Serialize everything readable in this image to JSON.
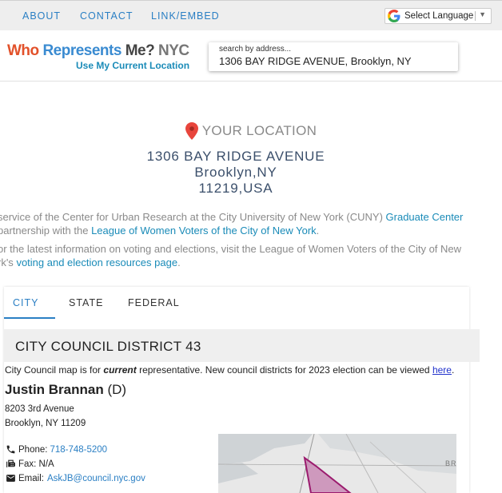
{
  "nav": {
    "links": [
      "ABOUT",
      "CONTACT",
      "LINK/EMBED"
    ],
    "language_label": "Select Language"
  },
  "header": {
    "logo": {
      "who": "Who",
      "represents": "Represents",
      "me": "Me?",
      "nyc": "NYC"
    },
    "current_location_label": "Use My Current Location",
    "search_label": "search by address...",
    "search_value": "1306 BAY RIDGE AVENUE, Brooklyn, NY"
  },
  "location": {
    "title": "YOUR LOCATION",
    "street": "1306 BAY RIDGE AVENUE",
    "city": "Brooklyn,NY",
    "zip": "11219,USA"
  },
  "intro": {
    "line1_text": "service of the Center for Urban Research at the City University of New York (CUNY)",
    "line1_link": "Graduate Center",
    "line2_text": "partnership with the",
    "line2_link": "League of Women Voters of the City of New York",
    "line3_text": "or the latest information on voting and elections, visit the League of Women Voters of the City of New",
    "line4_text": "rk's",
    "line4_link": "voting and election resources page"
  },
  "tabs": [
    "CITY",
    "STATE",
    "FEDERAL"
  ],
  "district": {
    "title": "CITY COUNCIL DISTRICT 43",
    "note_prefix": "City Council map is for",
    "note_emph": "current",
    "note_mid": "representative. New council districts for 2023 election can be viewed",
    "note_link": "here",
    "rep_name": "Justin Brannan",
    "rep_party": "(D)",
    "address_line1": "8203 3rd Avenue",
    "address_line2": "Brooklyn, NY 11209",
    "phone_label": "Phone:",
    "phone": "718-748-5200",
    "fax_label": "Fax: N/A",
    "email_label": "Email:",
    "email": "AskJB@council.nyc.gov",
    "map_label": "BR"
  }
}
